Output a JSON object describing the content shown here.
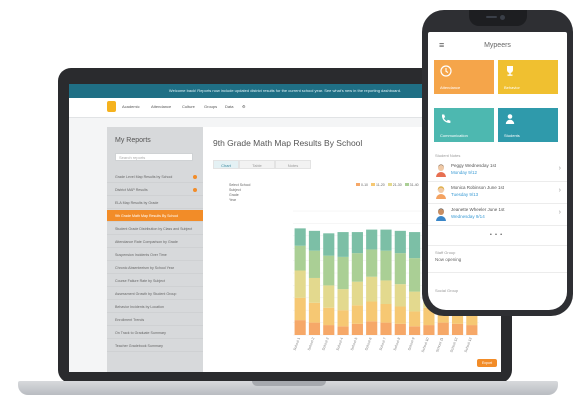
{
  "laptop": {
    "banner": "Welcome back! Reports now include updated district results for the current school year. See what's new in the reporting dashboard.",
    "nav_items": [
      "Academic",
      "Attendance",
      "Culture",
      "Groups",
      "Data",
      "⚙"
    ],
    "sidebar": {
      "title": "My Reports",
      "search_placeholder": "Search reports",
      "items": [
        {
          "label": "Grade Level Map Results by School",
          "alert": true
        },
        {
          "label": "District MAP Results",
          "alert": true
        },
        {
          "label": "ELA Map Results by Grade",
          "alert": false
        },
        {
          "label": "9th Grade Math Map Results By School",
          "alert": false,
          "active": true
        },
        {
          "label": "Student Grade Distribution by Class and Subject",
          "alert": false
        },
        {
          "label": "Attendance Rate Comparison by Grade",
          "alert": false
        },
        {
          "label": "Suspension Incidents Over Time",
          "alert": false
        },
        {
          "label": "Chronic Absenteeism by School Year",
          "alert": false
        },
        {
          "label": "Course Failure Rate by Subject",
          "alert": false
        },
        {
          "label": "Assessment Growth by Student Group",
          "alert": false
        },
        {
          "label": "Behavior Incidents by Location",
          "alert": false
        },
        {
          "label": "Enrollment Trends",
          "alert": false
        },
        {
          "label": "On Track to Graduate Summary",
          "alert": false
        },
        {
          "label": "Teacher Gradebook Summary",
          "alert": false
        }
      ]
    },
    "main": {
      "title": "9th Grade Math Map Results By School",
      "tabs": [
        "Chart",
        "Table",
        "Notes"
      ],
      "legend_left": [
        "Select School",
        "Subject",
        "Grade",
        "Year"
      ],
      "legend_right": [
        "0-10",
        "11-20",
        "21-30",
        "31-40",
        "41-50",
        "51-60",
        "61-70",
        "71-80",
        "81-90",
        "91-99"
      ],
      "export_label": "Export"
    }
  },
  "chart_data": {
    "type": "bar",
    "title": "",
    "categories": [
      "School 1",
      "School 2",
      "School 3",
      "School 4",
      "School 5",
      "School 6",
      "School 7",
      "School 8",
      "School 9",
      "School 10",
      "School 11",
      "School 12",
      "School 13"
    ],
    "series": [
      {
        "values": [
          12,
          10,
          8,
          7,
          9,
          11,
          10,
          9,
          7,
          8,
          10,
          9,
          8
        ]
      },
      {
        "values": [
          18,
          16,
          14,
          13,
          15,
          16,
          15,
          14,
          12,
          14,
          16,
          15,
          14
        ]
      },
      {
        "values": [
          22,
          20,
          18,
          17,
          19,
          20,
          19,
          18,
          16,
          18,
          20,
          19,
          18
        ]
      },
      {
        "values": [
          20,
          22,
          24,
          26,
          23,
          22,
          24,
          25,
          27,
          24,
          22,
          23,
          25
        ]
      },
      {
        "values": [
          14,
          16,
          18,
          20,
          17,
          16,
          17,
          18,
          21,
          19,
          17,
          18,
          19
        ]
      }
    ],
    "colors": [
      "#f6a868",
      "#f6c873",
      "#e3d98e",
      "#aacf95",
      "#7cbfa6"
    ],
    "ylim": [
      0,
      100
    ],
    "grid": true
  },
  "phone": {
    "title": "Mypeers",
    "tiles": [
      {
        "label": "Attendance",
        "color": "#f5a54a",
        "icon": "clock-icon"
      },
      {
        "label": "Behavior",
        "color": "#f0c030",
        "icon": "trophy-icon"
      },
      {
        "label": "Communication",
        "color": "#4db8b0",
        "icon": "phone-icon"
      },
      {
        "label": "Students",
        "color": "#2f9aab",
        "icon": "person-icon"
      }
    ],
    "section_label": "Student Notes",
    "rows": [
      {
        "name": "Peggy Wednesday 1st",
        "when": "Monday 9/12"
      },
      {
        "name": "Monica Robinson June 1st",
        "when": "Tuesday 9/13"
      },
      {
        "name": "Jeanette Wheeler June 1st",
        "when": "Wednesday 9/14"
      }
    ],
    "pager": "• • •",
    "blocks": [
      {
        "label": "Staff Group",
        "value": "Now opening"
      },
      {
        "label": "Social Group",
        "value": ""
      }
    ]
  }
}
